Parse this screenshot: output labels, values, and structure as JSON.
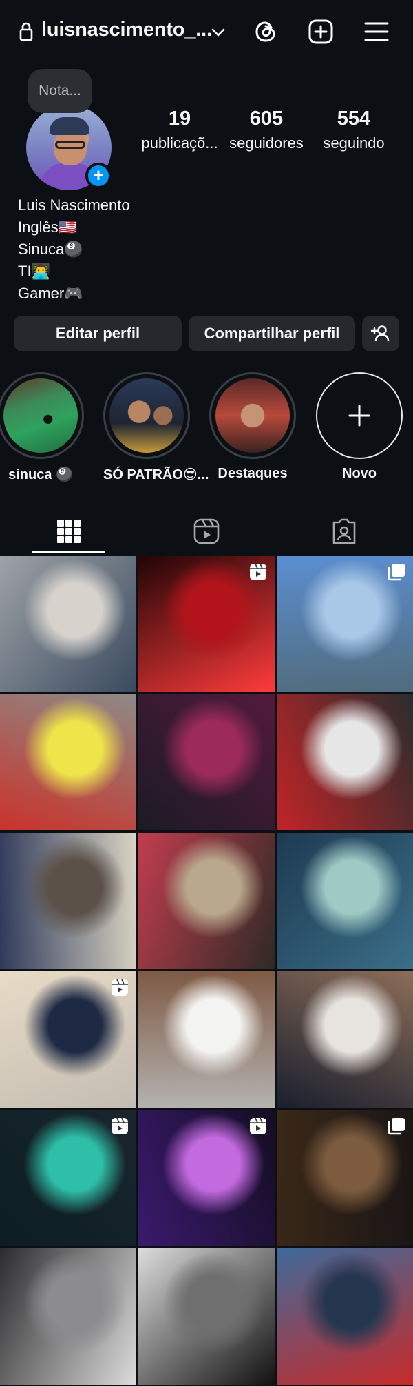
{
  "header": {
    "username": "luisnascimento_...",
    "icons": [
      "lock-icon",
      "chevron-down-icon",
      "threads-icon",
      "add-post-icon",
      "menu-icon"
    ]
  },
  "profile": {
    "note": "Nota...",
    "stats": [
      {
        "value": "19",
        "label": "publicaçõ..."
      },
      {
        "value": "605",
        "label": "seguidores"
      },
      {
        "value": "554",
        "label": "seguindo"
      }
    ],
    "bio": [
      "Luis Nascimento",
      "Inglês🇺🇸",
      "Sinuca🎱",
      "TI👨‍💻",
      "Gamer🎮"
    ]
  },
  "actions": {
    "edit": "Editar perfil",
    "share": "Compartilhar perfil"
  },
  "highlights": [
    {
      "label": "sinuca 🎱"
    },
    {
      "label": "SÓ PATRÃO😎..."
    },
    {
      "label": "Destaques"
    },
    {
      "label": "Novo"
    }
  ],
  "tabs": [
    "grid-icon",
    "reels-icon",
    "tagged-icon"
  ],
  "grid": [
    {
      "indicator": "none",
      "colors": [
        "#9ea3a6",
        "#d7d3cc",
        "#3a4a5f"
      ]
    },
    {
      "indicator": "reel",
      "colors": [
        "#200506",
        "#b3141c",
        "#ff3b3b"
      ]
    },
    {
      "indicator": "carousel",
      "colors": [
        "#5b8fd1",
        "#a9c8e8",
        "#516b7c"
      ]
    },
    {
      "indicator": "none",
      "colors": [
        "#8e8a86",
        "#efe54b",
        "#c9332b"
      ]
    },
    {
      "indicator": "none",
      "colors": [
        "#521a3c",
        "#9c2b5a",
        "#1c1a25"
      ]
    },
    {
      "indicator": "none",
      "colors": [
        "#2a2d2e",
        "#e6e6e6",
        "#c22427"
      ]
    },
    {
      "indicator": "none",
      "colors": [
        "#d9d4c3",
        "#5b5149",
        "#2f3a5a"
      ]
    },
    {
      "indicator": "none",
      "colors": [
        "#2e2a25",
        "#b9a88d",
        "#c23d4f"
      ]
    },
    {
      "indicator": "none",
      "colors": [
        "#3b6e88",
        "#9ec9c4",
        "#1e3a52"
      ]
    },
    {
      "indicator": "reel",
      "colors": [
        "#c3bcb2",
        "#1e2a44",
        "#e8dbc6"
      ]
    },
    {
      "indicator": "none",
      "colors": [
        "#b4b2b0",
        "#f3f3f1",
        "#7f5a45"
      ]
    },
    {
      "indicator": "none",
      "colors": [
        "#1a1f2e",
        "#e7e3df",
        "#8b6d59"
      ]
    },
    {
      "indicator": "reel",
      "colors": [
        "#0c1d24",
        "#2fbfa8",
        "#1a262d"
      ]
    },
    {
      "indicator": "reel",
      "colors": [
        "#3a1a6d",
        "#c36adf",
        "#140d22"
      ]
    },
    {
      "indicator": "carousel",
      "colors": [
        "#3a2818",
        "#7c5b3e",
        "#1a1515"
      ]
    },
    {
      "indicator": "none",
      "colors": [
        "#2c2c2e",
        "#8c8c8f",
        "#dcdcdc"
      ]
    },
    {
      "indicator": "none",
      "colors": [
        "#dcdcdc",
        "#6f6f6f",
        "#111111"
      ]
    },
    {
      "indicator": "none",
      "colors": [
        "#3e6a9a",
        "#25364f",
        "#c72a2a"
      ]
    }
  ]
}
